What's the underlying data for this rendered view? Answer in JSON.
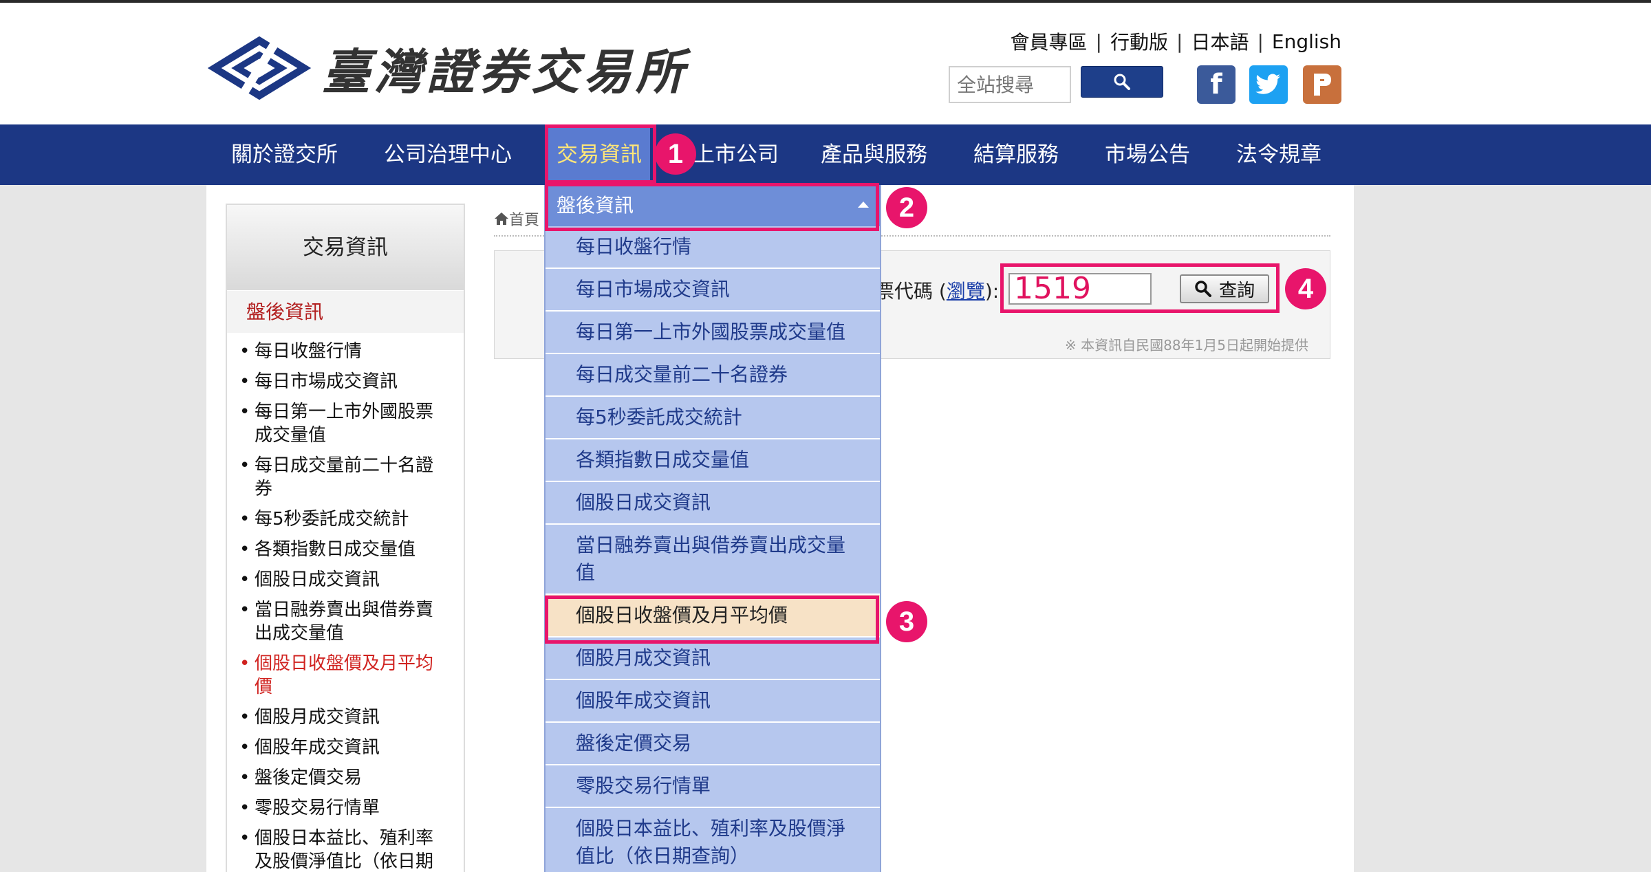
{
  "header": {
    "logo_text": "臺灣證券交易所",
    "top_links": [
      "會員專區",
      "行動版",
      "日本語",
      "English"
    ],
    "search_placeholder": "全站搜尋",
    "social": [
      "facebook-icon",
      "twitter-icon",
      "plurk-icon"
    ]
  },
  "nav": {
    "items": [
      "關於證交所",
      "公司治理中心",
      "交易資訊",
      "上市公司",
      "產品與服務",
      "結算服務",
      "市場公告",
      "法令規章"
    ],
    "active_index": 2
  },
  "sidebar": {
    "title": "交易資訊",
    "section": "盤後資訊",
    "items": [
      "每日收盤行情",
      "每日市場成交資訊",
      "每日第一上市外國股票成交量值",
      "每日成交量前二十名證券",
      "每5秒委託成交統計",
      "各類指數日成交量值",
      "個股日成交資訊",
      "當日融券賣出與借券賣出成交量值",
      "個股日收盤價及月平均價",
      "個股月成交資訊",
      "個股年成交資訊",
      "盤後定價交易",
      "零股交易行情單",
      "個股日本益比、殖利率及股價淨值比（依日期"
    ],
    "current_index": 8
  },
  "breadcrumb": {
    "home": "首頁"
  },
  "query": {
    "label_prefix": "票代碼 (",
    "label_link": "瀏覽",
    "label_suffix": "):",
    "stock_code": "1519",
    "button": "查詢",
    "note": "※ 本資訊自民國88年1月5日起開始提供"
  },
  "dropdown": {
    "header": "盤後資訊",
    "items": [
      "每日收盤行情",
      "每日市場成交資訊",
      "每日第一上市外國股票成交量值",
      "每日成交量前二十名證券",
      "每5秒委託成交統計",
      "各類指數日成交量值",
      "個股日成交資訊",
      "當日融券賣出與借券賣出成交量值",
      "個股日收盤價及月平均價",
      "個股月成交資訊",
      "個股年成交資訊",
      "盤後定價交易",
      "零股交易行情單",
      "個股日本益比、殖利率及股價淨值比（依日期查詢）"
    ],
    "selected_index": 8
  },
  "annotations": [
    "1",
    "2",
    "3",
    "4"
  ],
  "colors": {
    "nav": "#1c3784",
    "annotation": "#e8156b",
    "dropdown": "#b6c7ee",
    "selected": "#f7e2c6"
  }
}
